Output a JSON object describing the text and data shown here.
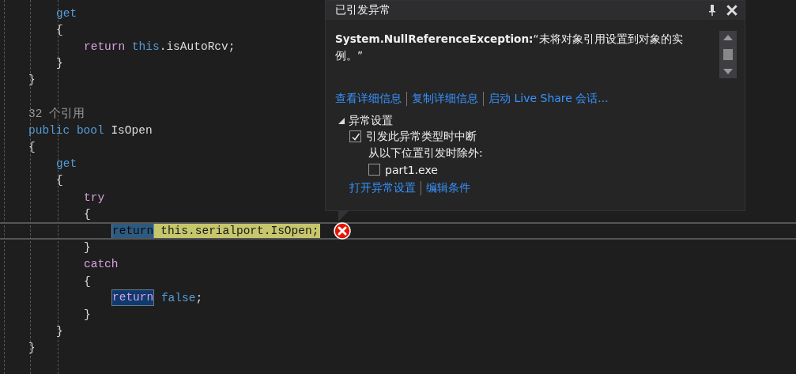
{
  "code_lines": [
    {
      "current": false,
      "tokens": [
        {
          "kind": "keyword",
          "text": "get"
        }
      ]
    },
    {
      "current": false,
      "tokens": [
        {
          "kind": "open",
          "text": "{"
        }
      ]
    },
    {
      "current": false,
      "tokens": [
        {
          "kind": "control",
          "text": "return"
        },
        {
          "kind": "this",
          "text": "this"
        },
        {
          "kind": "member",
          "text": ".isAutoRcv;"
        }
      ]
    },
    {
      "current": false,
      "tokens": [
        {
          "kind": "close",
          "text": "}"
        }
      ]
    },
    {
      "current": false,
      "tokens": [
        {
          "kind": "close",
          "text": "}"
        }
      ]
    },
    {
      "current": false,
      "blank_before": true,
      "tokens": [
        {
          "kind": "codelens",
          "text": "32 个引用"
        }
      ]
    },
    {
      "current": false,
      "tokens": [
        {
          "kind": "keyword",
          "text": "public"
        },
        {
          "kind": "keyword",
          "text": "bool"
        },
        {
          "kind": "plain",
          "text": "IsOpen"
        }
      ]
    },
    {
      "current": false,
      "tokens": [
        {
          "kind": "open",
          "text": "{"
        }
      ]
    },
    {
      "current": false,
      "tokens": [
        {
          "kind": "keyword",
          "text": "get"
        }
      ]
    },
    {
      "current": false,
      "tokens": [
        {
          "kind": "open",
          "text": "{"
        }
      ]
    },
    {
      "current": false,
      "tokens": [
        {
          "kind": "control",
          "text": "try"
        }
      ]
    },
    {
      "current": false,
      "tokens": [
        {
          "kind": "open",
          "text": "{"
        }
      ]
    },
    {
      "current": true,
      "tokens": [
        {
          "kind": "return_current",
          "text": "return"
        },
        {
          "kind": "statement",
          "text": "this.serialport.IsOpen;"
        }
      ]
    },
    {
      "current": false,
      "tokens": [
        {
          "kind": "close",
          "text": "}"
        }
      ]
    },
    {
      "current": false,
      "tokens": [
        {
          "kind": "control",
          "text": "catch"
        }
      ]
    },
    {
      "current": false,
      "tokens": [
        {
          "kind": "open",
          "text": "{"
        }
      ]
    },
    {
      "current": false,
      "tokens": [
        {
          "kind": "return_reference",
          "text": "return"
        },
        {
          "kind": "keyword",
          "text": "false"
        },
        {
          "kind": "punct",
          "text": ";"
        }
      ]
    },
    {
      "current": false,
      "tokens": [
        {
          "kind": "close",
          "text": "}"
        }
      ]
    },
    {
      "current": false,
      "tokens": [
        {
          "kind": "close",
          "text": "}"
        }
      ]
    },
    {
      "current": false,
      "tokens": [
        {
          "kind": "close",
          "text": "}"
        }
      ]
    }
  ],
  "popup": {
    "title": "已引发异常",
    "exception_type": "System.NullReferenceException:",
    "message": "“未将对象引用设置到对象的实例。”",
    "links": [
      "查看详细信息",
      "复制详细信息",
      "启动 Live Share 会话..."
    ],
    "settings": {
      "label": "异常设置",
      "expanded": true,
      "break_option": {
        "label": "引发此异常类型时中断",
        "checked": true
      },
      "except_label": "从以下位置引发时除外:",
      "modules": [
        {
          "label": "part1.exe",
          "checked": false
        }
      ]
    },
    "bottom_links": [
      "打开异常设置",
      "编辑条件"
    ]
  }
}
